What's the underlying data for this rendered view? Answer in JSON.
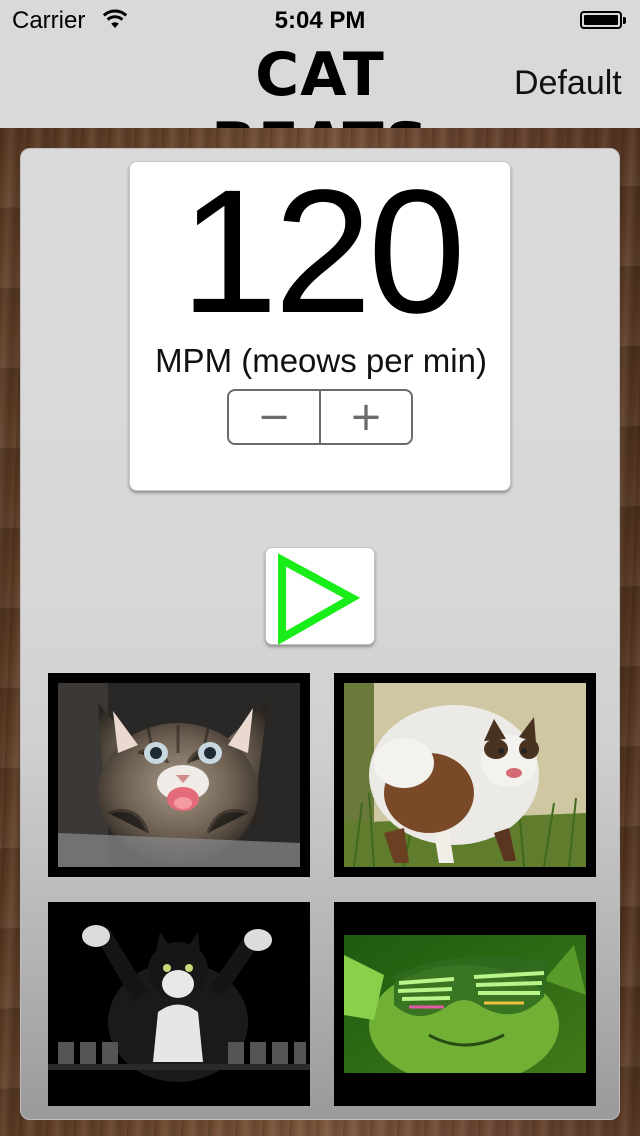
{
  "status_bar": {
    "carrier": "Carrier",
    "time": "5:04 PM",
    "wifi_icon": "wifi-icon",
    "battery_icon": "battery-icon"
  },
  "nav": {
    "title": "CAT BEATS",
    "right_button": "Default"
  },
  "tempo": {
    "value": "120",
    "unit_label": "MPM (meows per min)",
    "decrement_label": "−",
    "increment_label": "+"
  },
  "player": {
    "play_icon": "play-icon",
    "play_color": "#1aee1a"
  },
  "cats": [
    {
      "name": "kitten-meowing"
    },
    {
      "name": "fluffy-cat-hissing"
    },
    {
      "name": "tuxedo-cat-keyboard"
    },
    {
      "name": "green-cat-shutter-glasses"
    }
  ],
  "colors": {
    "nav_background": "#d9d9d9",
    "panel_background": "#d8d8d8",
    "wood": "#6e4a30"
  }
}
